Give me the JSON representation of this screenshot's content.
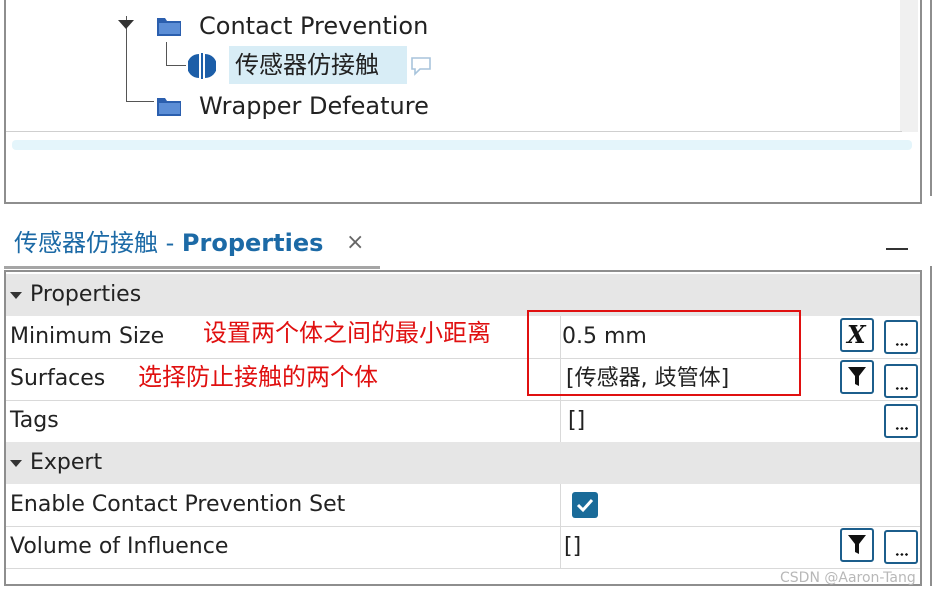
{
  "tree": {
    "items": [
      {
        "label": "Contact Prevention",
        "icon": "folder-icon"
      },
      {
        "label": "传感器仿接触",
        "icon": "contact-prevention-icon",
        "selected": true
      },
      {
        "label": "Wrapper Defeature",
        "icon": "folder-icon"
      }
    ]
  },
  "properties_panel": {
    "title_object": "传感器仿接触",
    "title_separator": " - ",
    "title_suffix": "Properties",
    "close_glyph": "×"
  },
  "property_grid": {
    "groups": [
      {
        "name": "Properties",
        "rows": [
          {
            "label": "Minimum Size",
            "value": "0.5 mm",
            "buttons": [
              "expression-button",
              "more-button"
            ]
          },
          {
            "label": "Surfaces",
            "value": "[传感器, 歧管体]",
            "buttons": [
              "filter-button",
              "more-button"
            ]
          },
          {
            "label": "Tags",
            "value": "[]",
            "buttons": [
              "more-button"
            ]
          }
        ]
      },
      {
        "name": "Expert",
        "rows": [
          {
            "label": "Enable Contact Prevention Set",
            "value": "",
            "checked": true
          },
          {
            "label": "Volume of Influence",
            "value": "[]",
            "buttons": [
              "filter-button",
              "more-button"
            ]
          }
        ]
      }
    ],
    "expression_glyph": "X"
  },
  "annotations": {
    "minimum_size_note": "设置两个体之间的最小距离",
    "surfaces_note": "选择防止接触的两个体"
  },
  "watermark": "CSDN @Aaron-Tang",
  "colors": {
    "title_blue": "#1c6aa6",
    "selection_bg": "#d8edf6",
    "annotation_red": "#e01010",
    "checkbox_blue": "#1a6b99"
  }
}
